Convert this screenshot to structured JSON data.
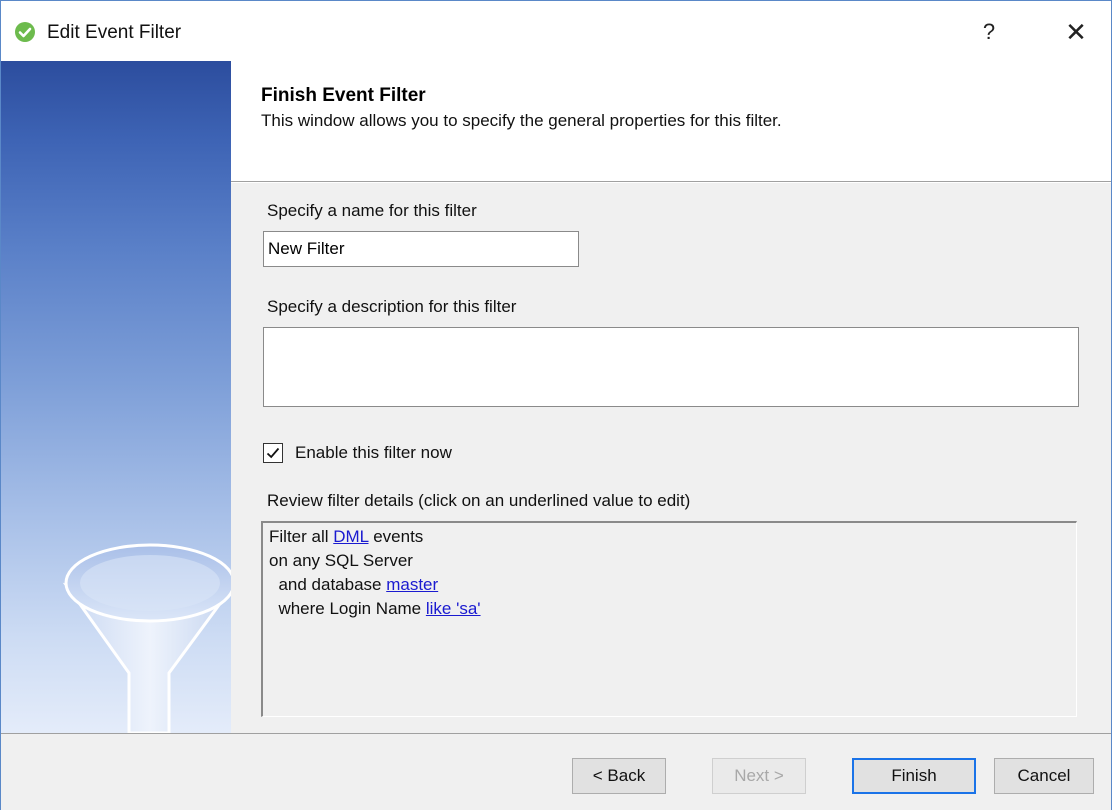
{
  "window": {
    "title": "Edit Event Filter",
    "help_glyph": "?",
    "close_glyph": "✕",
    "icon": "green-check-circle-icon"
  },
  "header": {
    "title": "Finish Event Filter",
    "subtitle": "This window allows you to specify the general properties for this filter."
  },
  "form": {
    "name_label": "Specify a name for this filter",
    "name_value": "New Filter",
    "description_label": "Specify a description for this filter",
    "description_value": "",
    "enable_label": "Enable this filter now",
    "enable_checked": true,
    "review_label": "Review filter details (click on an underlined value to edit)"
  },
  "details": {
    "line1_prefix": "Filter all ",
    "line1_link": "DML",
    "line1_suffix": " events",
    "line2": "on any SQL Server",
    "line3_prefix": "  and database ",
    "line3_link": "master",
    "line4_prefix": "  where Login Name ",
    "line4_link": "like 'sa'"
  },
  "buttons": {
    "back": "< Back",
    "next": "Next >",
    "finish": "Finish",
    "cancel": "Cancel"
  },
  "colors": {
    "link": "#1a1ad0",
    "panel_top": "#2c4d9e",
    "panel_bottom": "#e4ecfa",
    "icon_green": "#6dbb4d",
    "default_button_border": "#1a73e8"
  }
}
